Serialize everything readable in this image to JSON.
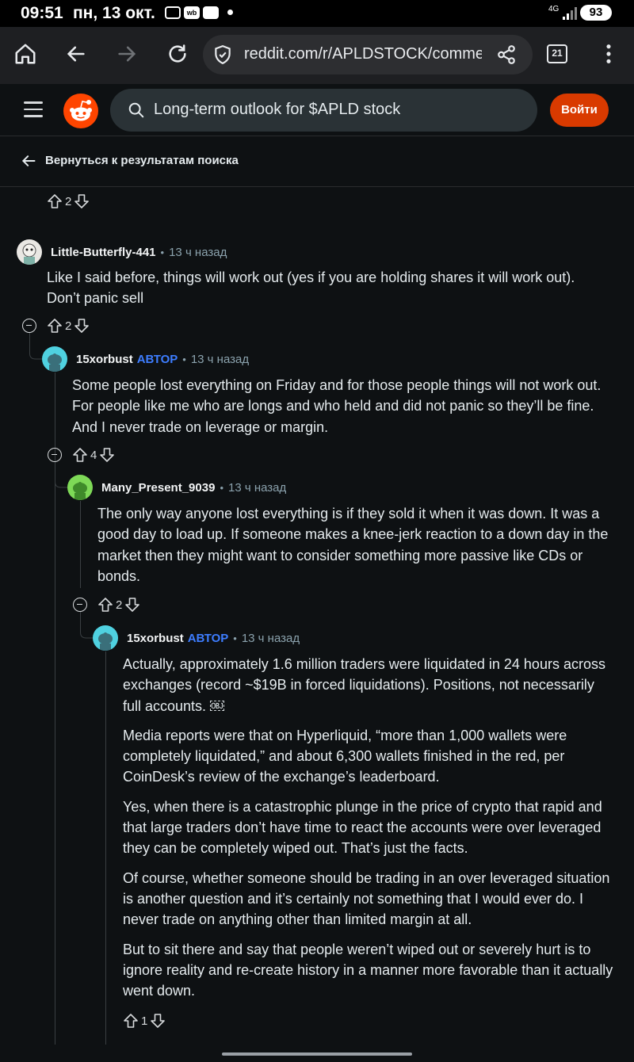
{
  "status": {
    "time": "09:51",
    "date": "пн, 13 окт.",
    "network": "4G",
    "battery": "93",
    "wb": "wb"
  },
  "browser": {
    "url": "reddit.com/r/APLDSTOCK/comments",
    "tab_count": "21"
  },
  "header": {
    "search_value": "Long-term outlook for $APLD stock",
    "login_label": "Войти"
  },
  "back": {
    "label": "Вернуться к результатам поиска"
  },
  "top_vote": {
    "count": "2"
  },
  "comments": [
    {
      "author": "Little-Butterfly-441",
      "badge": "",
      "time": "13 ч назад",
      "paragraphs": [
        "Like I said before, things will work out (yes if you are holding shares it will work out). Don’t panic sell"
      ],
      "votes": "2"
    },
    {
      "author": "15xorbust",
      "badge": "АВТОР",
      "time": "13 ч назад",
      "paragraphs": [
        "Some people lost everything on Friday and for those people things will not work out. For people like me who are longs and who held and did not panic so they’ll be fine. And I never trade on leverage or margin."
      ],
      "votes": "4"
    },
    {
      "author": "Many_Present_9039",
      "badge": "",
      "time": "13 ч назад",
      "paragraphs": [
        "The only way anyone lost everything is if they sold it when it was down. It was a good day to load up. If someone makes a knee-jerk reaction to a down day in the market then they might want to consider something more passive like CDs or bonds."
      ],
      "votes": "2"
    },
    {
      "author": "15xorbust",
      "badge": "АВТОР",
      "time": "13 ч назад",
      "paragraphs": [
        "Actually, approximately 1.6 million traders were liquidated in 24 hours across exchanges (record ~$19B in forced liquidations). Positions, not necessarily full accounts. ￼",
        "Media reports were that on Hyperliquid, “more than 1,000 wallets were completely liquidated,” and about 6,300 wallets finished in the red, per CoinDesk’s review of the exchange’s leaderboard.",
        "Yes, when there is a catastrophic plunge in the price of crypto that rapid and that large traders don’t have time to react the accounts were over leveraged they can be completely wiped out. That’s just the facts.",
        "Of course, whether someone should be trading in an over leveraged situation is another question and it’s certainly not something that I would ever do. I never trade on anything other than limited margin at all.",
        "But to sit there and say that people weren’t wiped out or severely hurt is to ignore reality and re-create history in a manner more favorable than it actually went down."
      ],
      "votes": "1"
    }
  ],
  "separator": "•"
}
